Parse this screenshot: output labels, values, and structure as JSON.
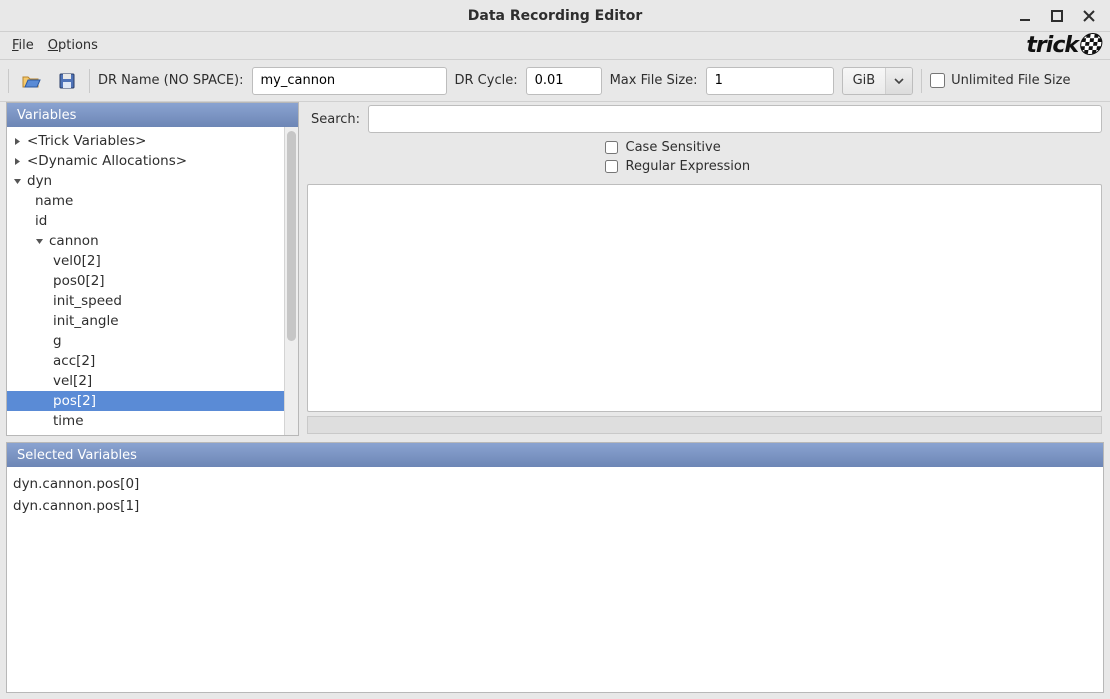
{
  "window": {
    "title": "Data Recording Editor"
  },
  "menubar": {
    "file": "File",
    "options": "Options",
    "brand": "trick"
  },
  "toolbar": {
    "dr_name_label": "DR Name (NO SPACE):",
    "dr_name_value": "my_cannon",
    "dr_cycle_label": "DR Cycle:",
    "dr_cycle_value": "0.01",
    "max_file_label": "Max File Size:",
    "max_file_value": "1",
    "unit_label": "GiB",
    "unlimited_label": "Unlimited File Size",
    "unlimited_checked": false
  },
  "search": {
    "label": "Search:",
    "value": "",
    "case_sensitive_label": "Case Sensitive",
    "case_sensitive_checked": false,
    "regex_label": "Regular Expression",
    "regex_checked": false
  },
  "panels": {
    "variables_header": "Variables",
    "selected_header": "Selected Variables"
  },
  "tree": {
    "n0": "<Trick Variables>",
    "n1": "<Dynamic Allocations>",
    "n2": "dyn",
    "n2_children": {
      "c0": "name",
      "c1": "id",
      "c2": "cannon",
      "c2_children": {
        "g0": "vel0[2]",
        "g1": "pos0[2]",
        "g2": "init_speed",
        "g3": "init_angle",
        "g4": "g",
        "g5": "acc[2]",
        "g6": "vel[2]",
        "g7": "pos[2]",
        "g8": "time"
      }
    },
    "selected_path": "dyn.cannon.pos[2]"
  },
  "selected_variables": {
    "r0": "dyn.cannon.pos[0]",
    "r1": "dyn.cannon.pos[1]"
  }
}
